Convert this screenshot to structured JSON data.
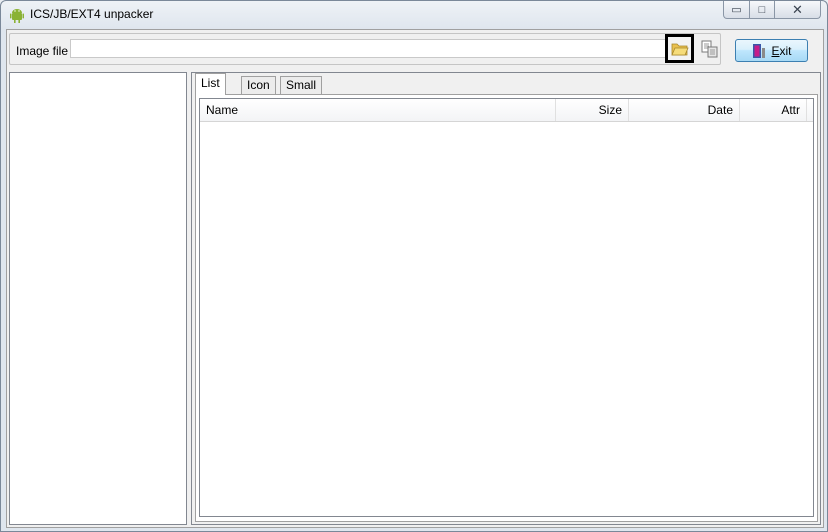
{
  "window": {
    "title": "ICS/JB/EXT4 unpacker",
    "controls": {
      "minimize_glyph": "▭",
      "maximize_glyph": "□",
      "close_glyph": "✕"
    }
  },
  "toolbar": {
    "image_label": "Image file :",
    "image_value": "",
    "open_icon": "folder-open-icon",
    "extract_icon": "extract-icon",
    "exit_label_prefix": "E",
    "exit_label_rest": "xit"
  },
  "tabs": [
    {
      "label": "List",
      "active": true
    },
    {
      "label": "Icon",
      "active": false
    },
    {
      "label": "Small",
      "active": false
    }
  ],
  "list": {
    "columns": [
      "Name",
      "Size",
      "Date",
      "Attr"
    ],
    "rows": []
  },
  "colors": {
    "accent": "#3c7fb1",
    "exit_icon_door": "#c61c8a",
    "folder": "#f3d36a"
  }
}
